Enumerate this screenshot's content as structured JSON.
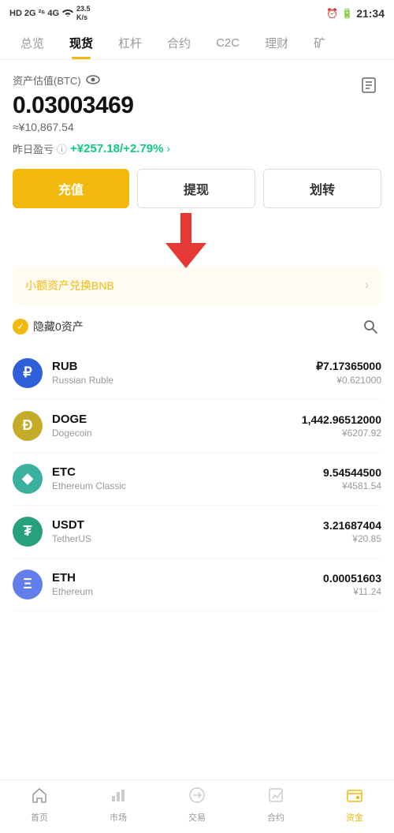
{
  "statusBar": {
    "left": "HD 2G 26 4G",
    "time": "21:34",
    "speed": "23.5 K/s",
    "battery": "20"
  },
  "navTabs": {
    "items": [
      "总览",
      "现货",
      "杠杆",
      "合约",
      "C2C",
      "理财",
      "矿"
    ]
  },
  "assetSection": {
    "label": "资产估值(BTC)",
    "btcValue": "0.03003469",
    "cnyApprox": "≈¥10,867.54",
    "pnlLabel": "昨日盈亏",
    "pnlValue": "+¥257.18/+2.79%",
    "buttons": {
      "deposit": "充值",
      "withdraw": "提现",
      "transfer": "划转"
    }
  },
  "smallAssets": {
    "text": "小额资产兑换BNB"
  },
  "filterRow": {
    "hideLabel": "隐藏0资产"
  },
  "cryptoList": [
    {
      "symbol": "RUB",
      "name": "Russian Ruble",
      "amount": "₽7.17365000",
      "cny": "¥0.621000",
      "iconType": "rub",
      "iconText": "₽"
    },
    {
      "symbol": "DOGE",
      "name": "Dogecoin",
      "amount": "1,442.96512000",
      "cny": "¥6207.92",
      "iconType": "doge",
      "iconText": "Ð"
    },
    {
      "symbol": "ETC",
      "name": "Ethereum Classic",
      "amount": "9.54544500",
      "cny": "¥4581.54",
      "iconType": "etc",
      "iconText": "◆"
    },
    {
      "symbol": "USDT",
      "name": "TetherUS",
      "amount": "3.21687404",
      "cny": "¥20.85",
      "iconType": "usdt",
      "iconText": "₮"
    },
    {
      "symbol": "ETH",
      "name": "Ethereum",
      "amount": "0.00051603",
      "cny": "¥11.24",
      "iconType": "eth",
      "iconText": "Ξ"
    }
  ],
  "bottomNav": {
    "items": [
      {
        "label": "首页",
        "active": false
      },
      {
        "label": "市场",
        "active": false
      },
      {
        "label": "交易",
        "active": false
      },
      {
        "label": "合约",
        "active": false
      },
      {
        "label": "资金",
        "active": true
      }
    ]
  }
}
